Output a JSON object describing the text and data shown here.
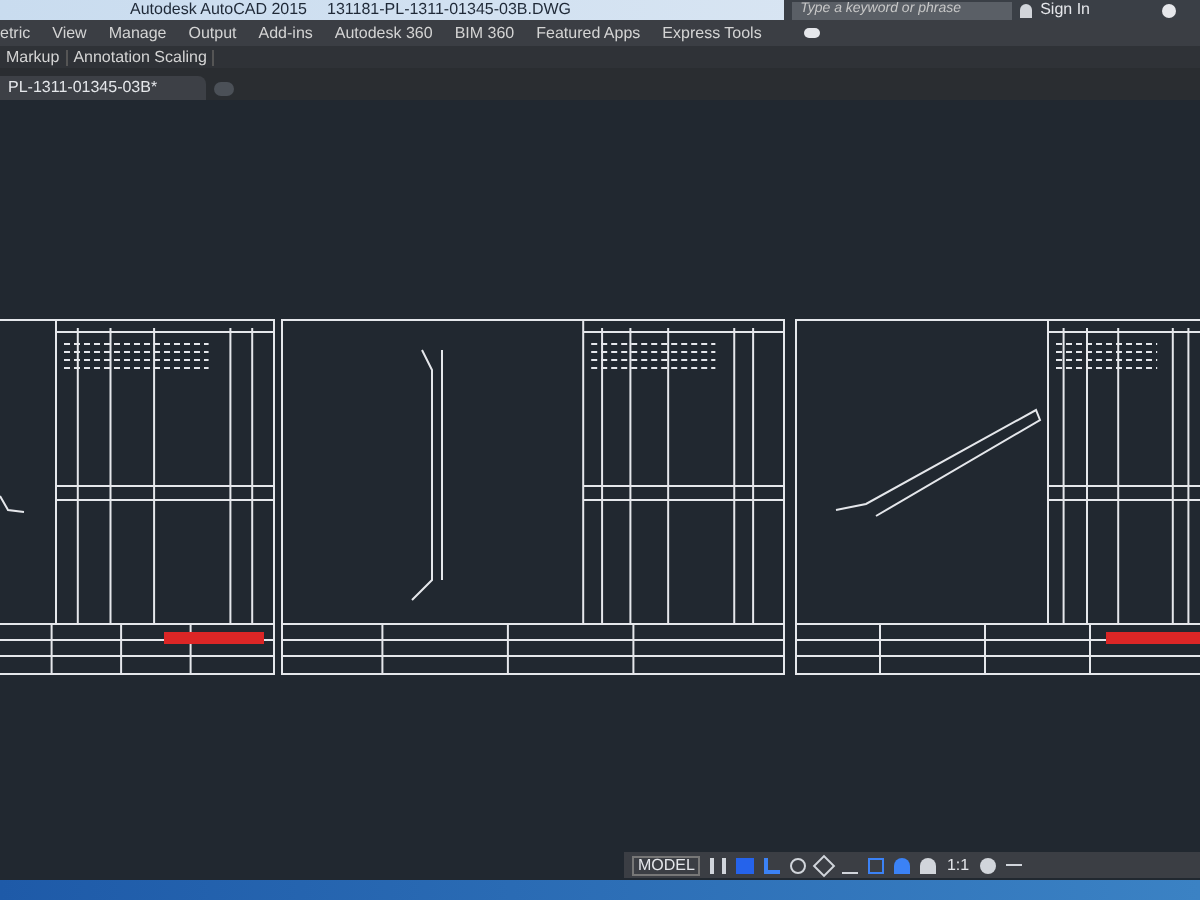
{
  "window": {
    "app_title": "Autodesk AutoCAD 2015",
    "file_title": "131181-PL-1311-01345-03B.DWG"
  },
  "search": {
    "placeholder": "Type a keyword or phrase"
  },
  "sign_in": "Sign In",
  "ribbon_tabs": [
    "etric",
    "View",
    "Manage",
    "Output",
    "Add-ins",
    "Autodesk 360",
    "BIM 360",
    "Featured Apps",
    "Express Tools"
  ],
  "panels": [
    "Markup",
    "Annotation Scaling"
  ],
  "file_tabs": [
    {
      "label": "PL-1311-01345-03B*",
      "selected": true
    }
  ],
  "status_bar": {
    "model": "MODEL",
    "scale": "1:1"
  }
}
